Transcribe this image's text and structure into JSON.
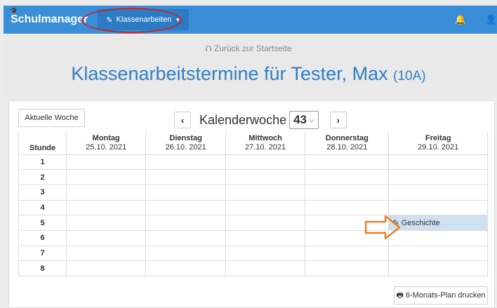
{
  "navbar": {
    "brand": "Schulmanager",
    "menu_label": "Klassenarbeiten",
    "accent": "#3a8dd7"
  },
  "header": {
    "back_link": "Zurück zur Startseite",
    "title": "Klassenarbeitstermine für Tester, Max",
    "class_label": "(10A)",
    "title_color": "#2f7fc5"
  },
  "controls": {
    "current_week_label": "Aktuelle Woche",
    "week_label": "Kalenderwoche",
    "week_number": "43",
    "print_label": "6-Monats-Plan drucken"
  },
  "table": {
    "stunde_header": "Stunde",
    "days": [
      {
        "name": "Montag",
        "date": "25.10. 2021"
      },
      {
        "name": "Dienstag",
        "date": "26.10. 2021"
      },
      {
        "name": "Mittwoch",
        "date": "27.10. 2021"
      },
      {
        "name": "Donnerstag",
        "date": "28.10. 2021"
      },
      {
        "name": "Freitag",
        "date": "29.10. 2021"
      }
    ],
    "periods": [
      "1",
      "2",
      "3",
      "4",
      "5",
      "6",
      "7",
      "8"
    ],
    "exam": {
      "label": "Geschichte",
      "day": "Freitag",
      "period": "5"
    }
  },
  "annotations": {
    "highlight_color": "#c8242b",
    "arrow_color": "#e8822a"
  }
}
